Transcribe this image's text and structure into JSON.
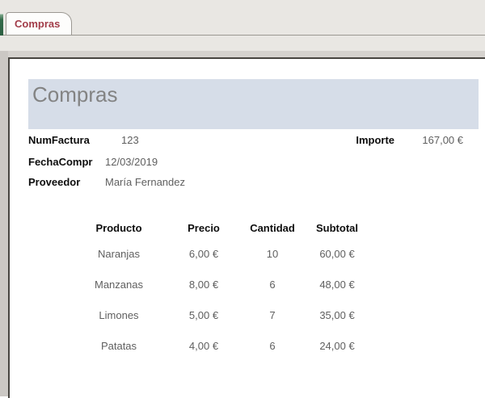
{
  "tab_bar": {
    "active_tab": "Compras"
  },
  "form": {
    "title": "Compras",
    "fields": [
      {
        "label": "NumFactura",
        "value": "123"
      },
      {
        "label": "FechaCompr",
        "value": "12/03/2019"
      },
      {
        "label": "Proveedor",
        "value": "María Fernandez"
      },
      {
        "label": "Importe",
        "value": "167,00 €"
      }
    ],
    "table": {
      "headers": [
        "Producto",
        "Precio",
        "Cantidad",
        "Subtotal"
      ],
      "rows": [
        [
          "Naranjas",
          "6,00 €",
          "10",
          "60,00 €"
        ],
        [
          "Manzanas",
          "8,00 €",
          "6",
          "48,00 €"
        ],
        [
          "Limones",
          "5,00 €",
          "7",
          "35,00 €"
        ],
        [
          "Patatas",
          "4,00 €",
          "6",
          "24,00 €"
        ]
      ]
    }
  },
  "colors": {
    "tab_text": "#a23c49",
    "chrome_bg": "#e9e7e3",
    "header_band": "#d6dde8",
    "title_text": "#838383",
    "label_text": "#0d0d0d",
    "value_text": "#5f5f5f",
    "form_border": "#474540",
    "nav_edge_green": "#336a49"
  }
}
